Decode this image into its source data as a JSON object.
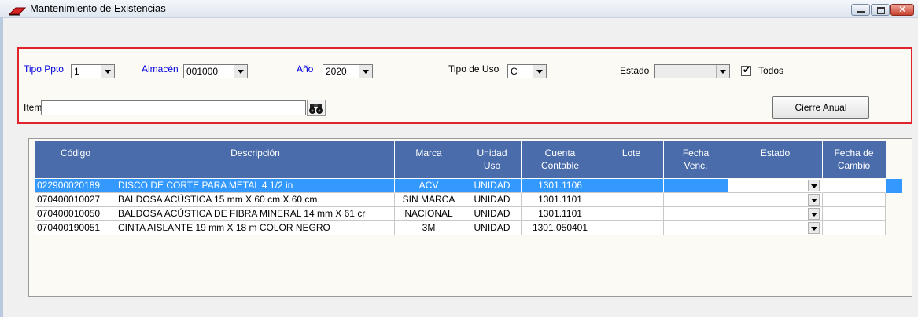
{
  "window": {
    "title": "Mantenimiento de Existencias"
  },
  "filters": {
    "tipo_ppto_label": "Tipo Ppto",
    "tipo_ppto_value": "1",
    "almacen_label": "Almacén",
    "almacen_value": "001000",
    "anio_label": "Año",
    "anio_value": "2020",
    "tipo_uso_label": "Tipo de Uso",
    "tipo_uso_value": "C",
    "estado_label": "Estado",
    "estado_value": "",
    "todos_label": "Todos",
    "todos_checked": true,
    "item_label": "Item",
    "item_value": "",
    "cierre_label": "Cierre Anual"
  },
  "table": {
    "headers": [
      {
        "l1": "Código",
        "l2": ""
      },
      {
        "l1": "Descripción",
        "l2": ""
      },
      {
        "l1": "Marca",
        "l2": ""
      },
      {
        "l1": "Unidad",
        "l2": "Uso"
      },
      {
        "l1": "Cuenta",
        "l2": "Contable"
      },
      {
        "l1": "Lote",
        "l2": ""
      },
      {
        "l1": "Fecha",
        "l2": "Venc."
      },
      {
        "l1": "Estado",
        "l2": ""
      },
      {
        "l1": "Fecha de",
        "l2": "Cambio"
      }
    ],
    "rows": [
      {
        "codigo": "022900020189",
        "descripcion": "DISCO DE CORTE PARA METAL 4 1/2 in",
        "marca": "ACV",
        "unidad": "UNIDAD",
        "cuenta": "1301.1106",
        "lote": "",
        "venc": "",
        "estado": "",
        "cambio": ""
      },
      {
        "codigo": "070400010027",
        "descripcion": "BALDOSA ACÚSTICA 15 mm X 60 cm X 60 cm",
        "marca": "SIN MARCA",
        "unidad": "UNIDAD",
        "cuenta": "1301.1101",
        "lote": "",
        "venc": "",
        "estado": "",
        "cambio": ""
      },
      {
        "codigo": "070400010050",
        "descripcion": "BALDOSA ACÚSTICA DE FIBRA MINERAL 14 mm X 61 cr",
        "marca": "NACIONAL",
        "unidad": "UNIDAD",
        "cuenta": "1301.1101",
        "lote": "",
        "venc": "",
        "estado": "",
        "cambio": ""
      },
      {
        "codigo": "070400190051",
        "descripcion": "CINTA AISLANTE 19 mm X 18 m COLOR NEGRO",
        "marca": "3M",
        "unidad": "UNIDAD",
        "cuenta": "1301.050401",
        "lote": "",
        "venc": "",
        "estado": "",
        "cambio": ""
      }
    ]
  },
  "colors": {
    "header": "#4a6cab",
    "selection": "#3399ff",
    "frame": "#e0232b",
    "label_blue": "#0000e0"
  }
}
